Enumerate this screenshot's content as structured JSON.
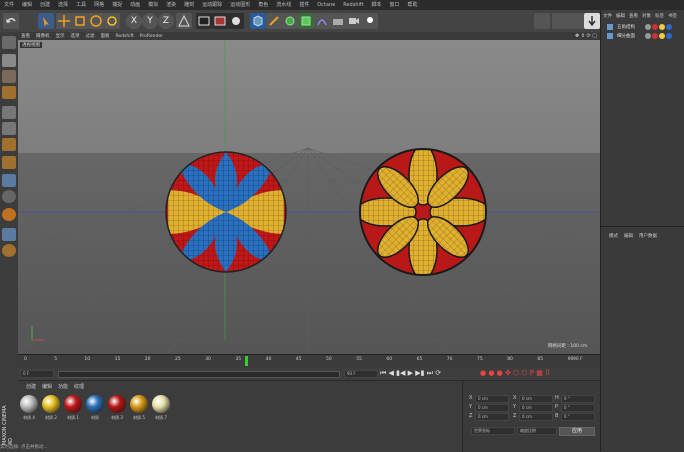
{
  "menubar": [
    "文件",
    "编辑",
    "创建",
    "选择",
    "工具",
    "网格",
    "捕捉",
    "动画",
    "模拟",
    "渲染",
    "雕刻",
    "运动跟踪",
    "运动图形",
    "角色",
    "流水线",
    "插件",
    "Octane",
    "Redshift",
    "脚本",
    "窗口",
    "帮助"
  ],
  "toolbar": {
    "x_label": "X",
    "y_label": "Y",
    "z_label": "Z"
  },
  "viewport": {
    "menu": [
      "查看",
      "摄像机",
      "显示",
      "选项",
      "过滤",
      "面板",
      "Redshift",
      "ProRender"
    ],
    "camera_label": "透视视图",
    "grid_spacing": "网格间距 : 100 cm"
  },
  "timeline": {
    "ticks": [
      "0",
      "5",
      "10",
      "15",
      "20",
      "25",
      "30",
      "35",
      "40",
      "45",
      "50",
      "55",
      "60",
      "65",
      "70",
      "75",
      "80",
      "85",
      "90"
    ],
    "end_frame": "90 F",
    "current_frame": "0 F",
    "start_field": "0 F",
    "end_field": "90 F",
    "current_field": "37 F"
  },
  "materials": {
    "tabs": [
      "创建",
      "编辑",
      "功能",
      "纹理"
    ],
    "items": [
      {
        "label": "材质.4",
        "color": "#bdbdbd"
      },
      {
        "label": "材质.2",
        "color": "#e8c020"
      },
      {
        "label": "材质.1",
        "color": "#c01818"
      },
      {
        "label": "材质",
        "color": "#2a6fb8"
      },
      {
        "label": "材质.3",
        "color": "#b81515"
      },
      {
        "label": "材质.5",
        "color": "#d89a18"
      },
      {
        "label": "材质.7",
        "color": "#e8e0a8"
      }
    ]
  },
  "coords": {
    "rows": [
      {
        "axis": "X",
        "pos": "0 cm",
        "axis2": "X",
        "size": "0 cm",
        "axis3": "H",
        "rot": "0 °"
      },
      {
        "axis": "Y",
        "pos": "0 cm",
        "axis2": "Y",
        "size": "0 cm",
        "axis3": "P",
        "rot": "0 °"
      },
      {
        "axis": "Z",
        "pos": "0 cm",
        "axis2": "Z",
        "size": "0 cm",
        "axis3": "B",
        "rot": "0 °"
      }
    ],
    "mode1": "世界坐标",
    "mode2": "缩放比例",
    "apply": "应用"
  },
  "right": {
    "tabs": [
      "文件",
      "编辑",
      "查看",
      "对象",
      "标签",
      "书签"
    ],
    "objects": [
      "五角结构",
      "细分曲面"
    ],
    "attr_tabs": [
      "模式",
      "编辑",
      "用户数据"
    ]
  },
  "brand": "MAXON CINEMA 4D",
  "statusbar": "实时选择: 点击并拖动..."
}
